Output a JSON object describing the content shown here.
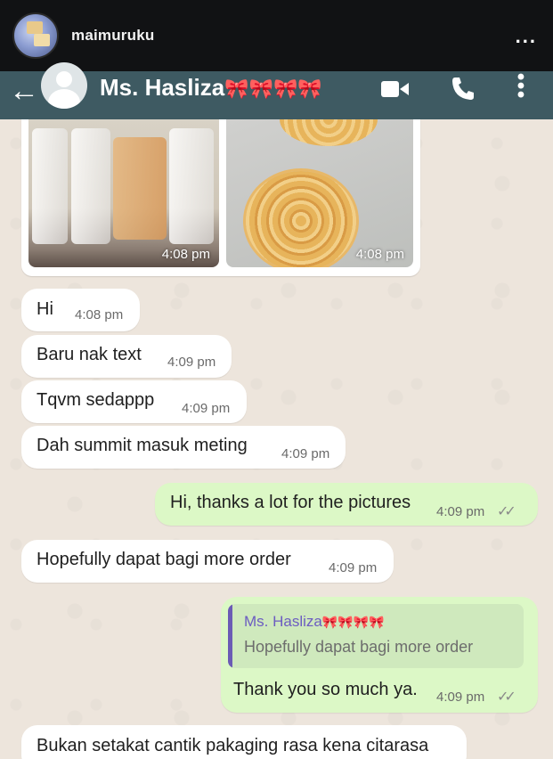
{
  "instagram": {
    "username": "maimuruku",
    "more": "..."
  },
  "whatsapp": {
    "contact_name": "Ms. Hasliza",
    "contact_emoji": "🎀🎀🎀🎀",
    "back_icon": "arrow-left-icon",
    "video_icon": "video-camera-icon",
    "call_icon": "phone-icon",
    "menu_icon": "more-vertical-icon"
  },
  "messages": {
    "image1_time": "4:08 pm",
    "image2_time": "4:08 pm",
    "m1": {
      "text": "Hi",
      "time": "4:08 pm"
    },
    "m2": {
      "text": "Baru nak text",
      "time": "4:09 pm"
    },
    "m3": {
      "text": "Tqvm sedappp",
      "time": "4:09 pm"
    },
    "m4": {
      "text": "Dah summit masuk meting",
      "time": "4:09 pm"
    },
    "m5": {
      "text": "Hi, thanks a lot for the pictures",
      "time": "4:09 pm",
      "status": "read"
    },
    "m6": {
      "text": "Hopefully dapat bagi more order",
      "time": "4:09 pm"
    },
    "m7": {
      "quote_name": "Ms. Hasliza",
      "quote_emoji": "🎀🎀🎀🎀",
      "quote_text": "Hopefully dapat bagi more order",
      "text": "Thank you so much ya.",
      "time": "4:09 pm",
      "status": "read"
    },
    "m8": {
      "text": "Bukan setakat cantik pakaging rasa kena citarasa"
    }
  },
  "colors": {
    "wa_header": "#3e5a62",
    "chat_bg": "#ede5dc",
    "outgoing": "#dcf8c6",
    "incoming": "#ffffff"
  }
}
